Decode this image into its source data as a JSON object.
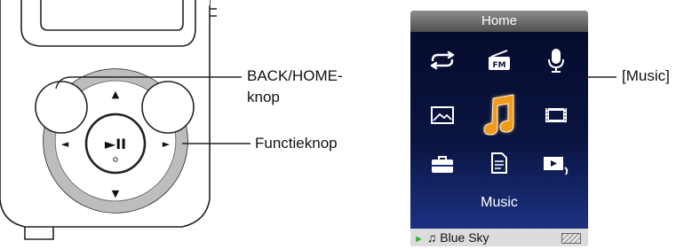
{
  "callouts": {
    "back_home_line1": "BACK/HOME-",
    "back_home_line2": "knop",
    "function_button": "Functieknop",
    "music": "[Music]"
  },
  "device": {
    "controls": {
      "up": "▲",
      "down": "▼",
      "left": "◄",
      "right": "►",
      "center": "►II"
    }
  },
  "screen": {
    "title": "Home",
    "menu_icons": [
      "shuffle-icon",
      "fm-radio-icon",
      "microphone-icon",
      "photo-icon",
      "music-note-icon",
      "video-icon",
      "settings-icon",
      "document-icon",
      "now-playing-icon"
    ],
    "selected_label": "Music",
    "now_playing": {
      "track": "Blue Sky",
      "play_glyph": "►",
      "note_glyph": "♫"
    },
    "colors": {
      "highlight": "#f39a1e",
      "play_indicator": "#21b829"
    }
  }
}
